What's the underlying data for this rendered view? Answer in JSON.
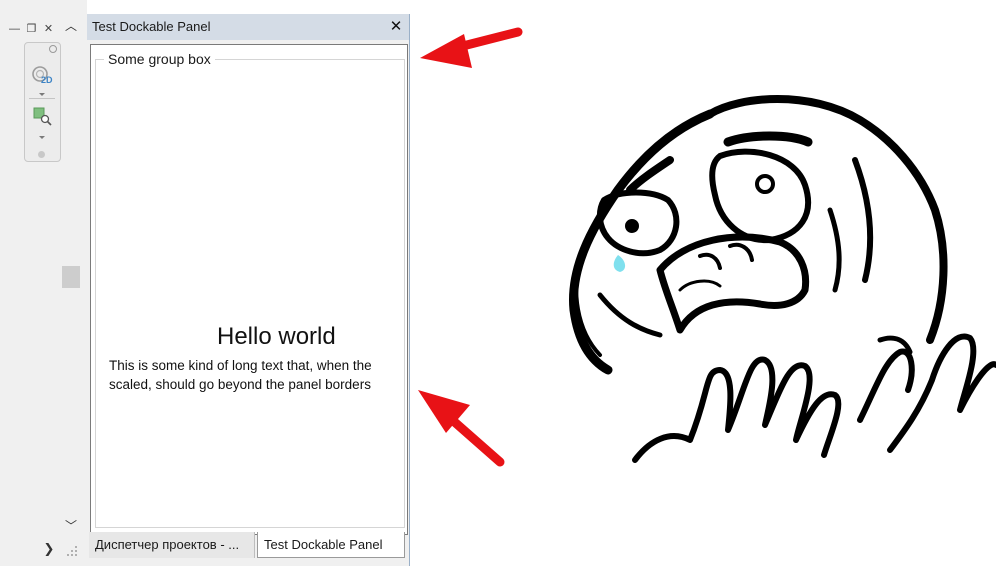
{
  "panel": {
    "title": "Test Dockable Panel",
    "close_glyph": "✕",
    "groupbox_label": "Some group box",
    "hello_text": "Hello world",
    "long_text_line1": "This is some kind of long text that, when the",
    "long_text_line2": "scaled, should go beyond the panel borders",
    "tabs": [
      {
        "label": "Диспетчер проектов - ..."
      },
      {
        "label": "Test Dockable Panel"
      }
    ]
  },
  "left_dock": {
    "window_buttons": [
      "—",
      "❐",
      "✕"
    ],
    "palette_icons": [
      "view-2d-icon",
      "zoom-window-icon"
    ],
    "badge_2d": "2D"
  },
  "colors": {
    "arrow": "#e81216",
    "teardrop": "#7fe0ee",
    "titlebar": "#d4dce6"
  }
}
